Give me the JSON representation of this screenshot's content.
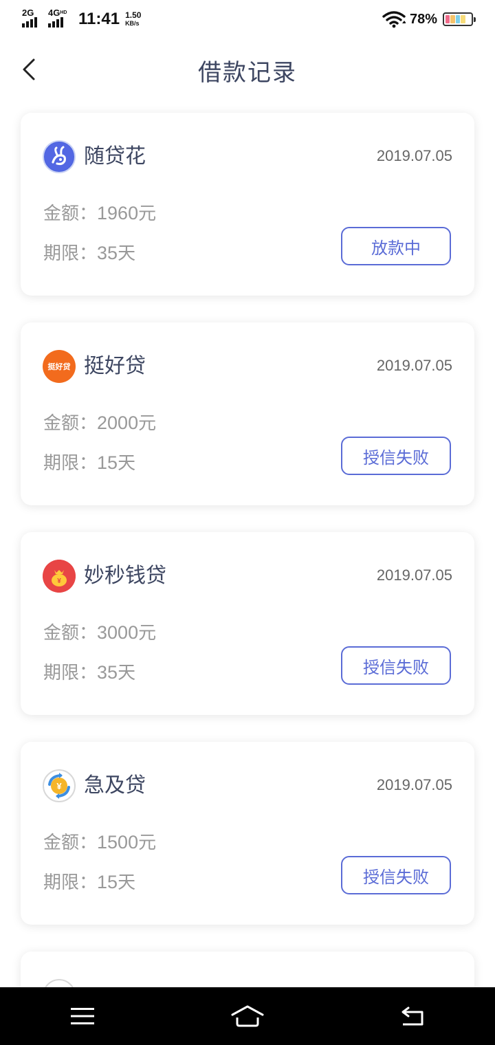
{
  "status_bar": {
    "network_1": "2G",
    "network_2": "4G",
    "network_2_sup": "HD",
    "time": "11:41",
    "speed_value": "1.50",
    "speed_unit": "KB/s",
    "battery_percent": "78%",
    "icons": [
      "signal-icon",
      "signal-icon",
      "wifi-icon",
      "battery-icon"
    ]
  },
  "header": {
    "title": "借款记录",
    "back_icon": "chevron-left-icon"
  },
  "labels": {
    "amount_prefix": "金额：",
    "amount_unit": "元",
    "term_prefix": "期限：",
    "term_unit": "天"
  },
  "loans": [
    {
      "name": "随贷花",
      "date": "2019.07.05",
      "amount": "1960",
      "term": "35",
      "status": "放款中",
      "logo": "suidaihua-logo",
      "logo_color": "#4a63e0"
    },
    {
      "name": "挺好贷",
      "date": "2019.07.05",
      "amount": "2000",
      "term": "15",
      "status": "授信失败",
      "logo": "tinghaodai-logo",
      "logo_text": "挺好贷",
      "logo_color": "#f26b1d"
    },
    {
      "name": "妙秒钱贷",
      "date": "2019.07.05",
      "amount": "3000",
      "term": "35",
      "status": "授信失败",
      "logo": "miaomiaoqiandai-logo",
      "logo_color": "#e84545"
    },
    {
      "name": "急及贷",
      "date": "2019.07.05",
      "amount": "1500",
      "term": "15",
      "status": "授信失败",
      "logo": "jijidai-logo",
      "logo_color": "#3d8ee0"
    }
  ],
  "nav": {
    "icons": [
      "menu-icon",
      "home-icon",
      "back-icon"
    ]
  }
}
